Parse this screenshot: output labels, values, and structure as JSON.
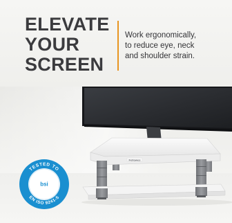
{
  "headline": {
    "lines": [
      "ELEVATE",
      "YOUR",
      "SCREEN"
    ]
  },
  "tagline": {
    "lines": [
      "Work ergonomically,",
      "to reduce eye, neck",
      "and shoulder strain."
    ]
  },
  "product": {
    "brand_mark": "Fellowes"
  },
  "seal": {
    "top_text": "TESTED TO",
    "center_text": "bsi",
    "bottom_text": "EN ISO 9241-5"
  },
  "colors": {
    "headline": "#3b3b3e",
    "divider_accent": "#e8941f",
    "seal_ring": "#1a8fd0",
    "stand": "#f2f2f2",
    "legs": "#8a8c90",
    "monitor": "#26282c"
  }
}
